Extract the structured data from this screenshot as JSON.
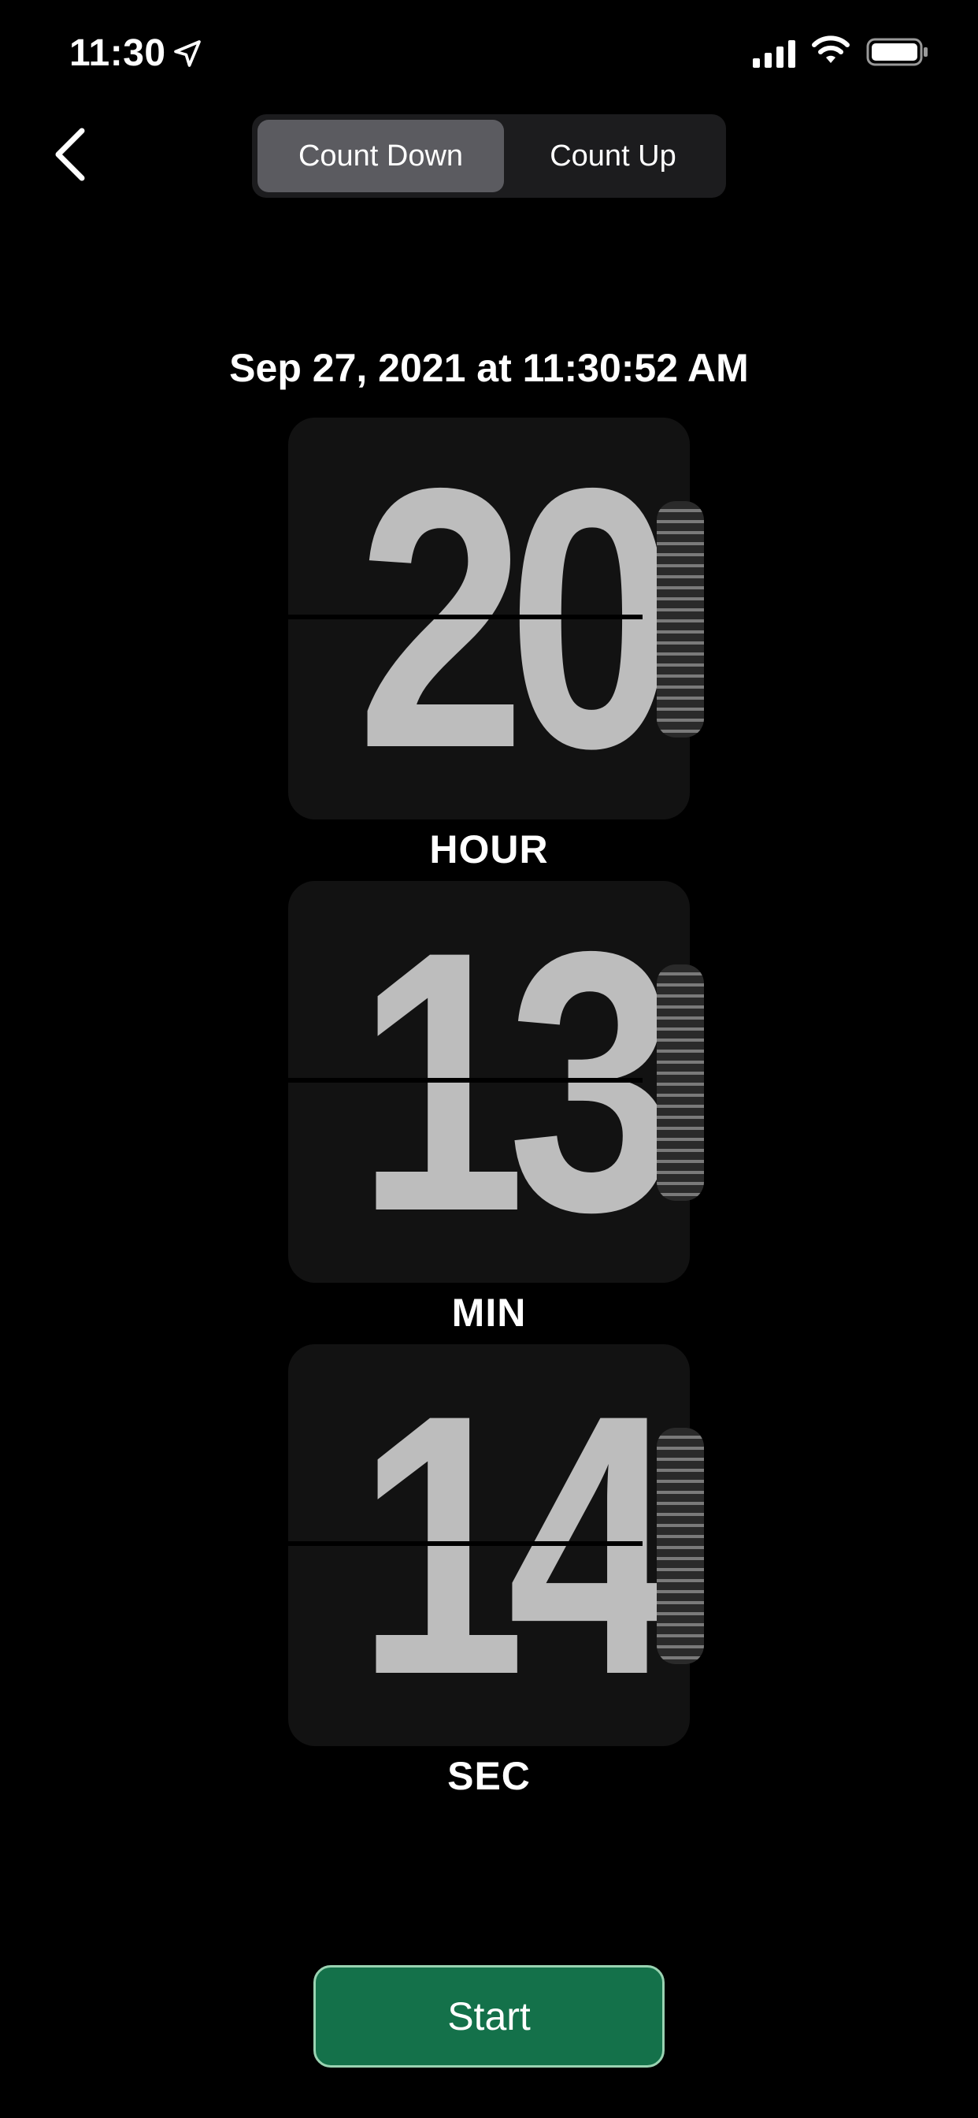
{
  "status_bar": {
    "time": "11:30",
    "icons": [
      "location-arrow-icon",
      "cellular-signal-icon",
      "wifi-icon",
      "battery-icon"
    ]
  },
  "header": {
    "back_icon": "chevron-left-icon",
    "segments": [
      {
        "label": "Count Down",
        "selected": true
      },
      {
        "label": "Count Up",
        "selected": false
      }
    ]
  },
  "target_date": "Sep 27, 2021 at 11:30:52 AM",
  "timer": {
    "hour": {
      "value": "20",
      "label": "HOUR"
    },
    "minute": {
      "value": "13",
      "label": "MIN"
    },
    "second": {
      "value": "14",
      "label": "SEC"
    }
  },
  "actions": {
    "start_label": "Start"
  },
  "colors": {
    "background": "#000000",
    "card": "#121212",
    "digit": "#bdbdbd",
    "segment_selected": "#5b5b60",
    "segment_track": "#1c1c1e",
    "start_button": "#14714a"
  }
}
